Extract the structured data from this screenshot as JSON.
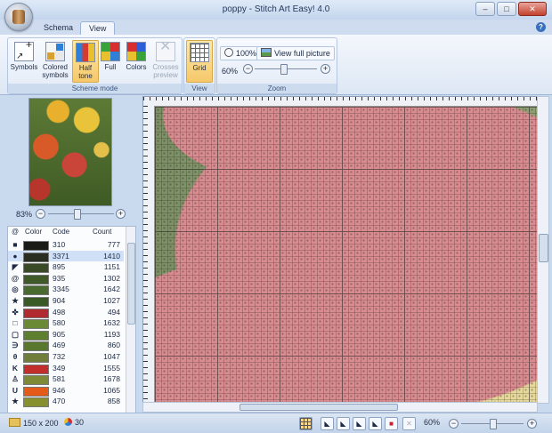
{
  "window": {
    "title": "poppy - Stitch Art Easy! 4.0",
    "min": "–",
    "max": "□",
    "close": "✕"
  },
  "tabs": [
    {
      "label": "Schema"
    },
    {
      "label": "View"
    }
  ],
  "help": "?",
  "ribbon": {
    "scheme_mode": {
      "label": "Scheme mode",
      "buttons": [
        {
          "label": "Symbols"
        },
        {
          "label": "Colored symbols"
        },
        {
          "label": "Half tone"
        },
        {
          "label": "Full"
        },
        {
          "label": "Colors"
        },
        {
          "label": "Crosses preview"
        }
      ]
    },
    "view": {
      "label": "View",
      "grid": "Grid"
    },
    "zoom": {
      "label": "Zoom",
      "hundred": "100%",
      "full_picture": "View full picture",
      "value": "60%",
      "level": 0.45
    }
  },
  "preview": {
    "zoom": "83%",
    "level": 0.42
  },
  "legend": {
    "headers": {
      "symbol": "@",
      "color": "Color",
      "code": "Code",
      "count": "Count"
    },
    "rows": [
      {
        "sym": "■",
        "color": "#1a1a16",
        "code": "310",
        "count": "777"
      },
      {
        "sym": "●",
        "color": "#2a2e20",
        "code": "3371",
        "count": "1410"
      },
      {
        "sym": "◤",
        "color": "#3b4a26",
        "code": "895",
        "count": "1151"
      },
      {
        "sym": "@",
        "color": "#3f5a28",
        "code": "935",
        "count": "1302"
      },
      {
        "sym": "◎",
        "color": "#4a6b30",
        "code": "3345",
        "count": "1642"
      },
      {
        "sym": "★",
        "color": "#3a5a25",
        "code": "904",
        "count": "1027"
      },
      {
        "sym": "✜",
        "color": "#b02a30",
        "code": "498",
        "count": "494"
      },
      {
        "sym": "□",
        "color": "#6b8a36",
        "code": "580",
        "count": "1632"
      },
      {
        "sym": "▢",
        "color": "#5f7f30",
        "code": "905",
        "count": "1193"
      },
      {
        "sym": "∋",
        "color": "#59782e",
        "code": "469",
        "count": "860"
      },
      {
        "sym": "θ",
        "color": "#6f7f3a",
        "code": "732",
        "count": "1047"
      },
      {
        "sym": "K",
        "color": "#c22e2c",
        "code": "349",
        "count": "1555"
      },
      {
        "sym": "♙",
        "color": "#7e8a36",
        "code": "581",
        "count": "1678"
      },
      {
        "sym": "U",
        "color": "#e45a18",
        "code": "946",
        "count": "1065"
      },
      {
        "sym": "★",
        "color": "#86902e",
        "code": "470",
        "count": "858"
      }
    ]
  },
  "status": {
    "size": "150 x 200",
    "colors": "30",
    "zoom": "60%",
    "zoom_level": 0.5
  }
}
